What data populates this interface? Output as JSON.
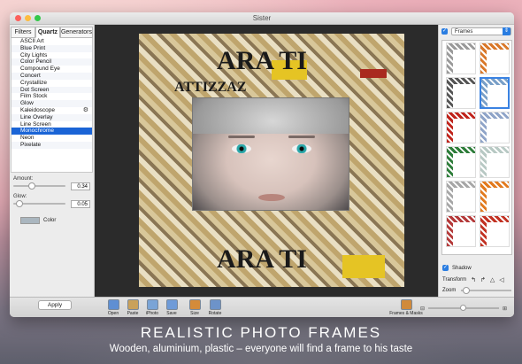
{
  "window": {
    "title": "Sister"
  },
  "left_panel": {
    "tabs": [
      {
        "label": "Filters",
        "active": false
      },
      {
        "label": "Quartz",
        "active": true
      },
      {
        "label": "Generators",
        "active": false
      }
    ],
    "filters": [
      "ASCII Art",
      "Blue Print",
      "City Lights",
      "Color Pencil",
      "Compound Eye",
      "Concert",
      "Crystallize",
      "Dot Screen",
      "Film Stock",
      "Glow",
      "Kaleidoscope",
      "Line Overlay",
      "Line Screen",
      "Monochrome",
      "Neon",
      "Pixelate"
    ],
    "selected_filter": "Monochrome",
    "amount": {
      "label": "Amount:",
      "value": "0.34",
      "level": 0.34
    },
    "glow": {
      "label": "Glow:",
      "value": "0.05",
      "level": 0.05
    },
    "color": {
      "label": "Color",
      "value_color": "#aab6bf"
    }
  },
  "canvas": {
    "frame_text_top": "ARA TI",
    "frame_text_mid": "ATTIZZAZ",
    "frame_text_bottom": "ARA TI",
    "frame_accent_colors": [
      "#e5c424",
      "#a92a1f"
    ]
  },
  "right_panel": {
    "frames_enabled": true,
    "category": "Frames",
    "thumbnails": [
      {
        "name": "frame-grey-stone",
        "color": "#9a9a9a"
      },
      {
        "name": "frame-orange-wood",
        "color": "#d9782a"
      },
      {
        "name": "frame-newspaper",
        "color": "#555555"
      },
      {
        "name": "frame-blue-sketch",
        "color": "#7aa0c8"
      },
      {
        "name": "frame-red",
        "color": "#c0241c"
      },
      {
        "name": "frame-steel-blue",
        "color": "#8fa4c8"
      },
      {
        "name": "frame-green-xmas",
        "color": "#2e7d3a"
      },
      {
        "name": "frame-floral",
        "color": "#b8c9c4"
      },
      {
        "name": "frame-silver-check",
        "color": "#a7a7a7"
      },
      {
        "name": "frame-orange-plain",
        "color": "#e27a1e"
      },
      {
        "name": "frame-candy",
        "color": "#b43a3a"
      },
      {
        "name": "frame-red-plain",
        "color": "#c23324"
      }
    ],
    "selected_thumbnail": 3,
    "shadow": {
      "label": "Shadow",
      "checked": true
    },
    "transform_label": "Transform",
    "transform_icons": [
      "↰",
      "↱",
      "△",
      "◁"
    ],
    "zoom_label": "Zoom"
  },
  "toolbar": {
    "apply_label": "Apply",
    "tools": [
      {
        "label": "Open",
        "icon": "open-icon",
        "color": "#5f8fd3"
      },
      {
        "label": "Paste",
        "icon": "paste-icon",
        "color": "#c9a15a"
      },
      {
        "label": "iPhoto",
        "icon": "iphoto-icon",
        "color": "#7aa4d6"
      },
      {
        "label": "Save",
        "icon": "save-icon",
        "color": "#6f9bd8"
      },
      {
        "label": "Size",
        "icon": "size-icon",
        "color": "#d48b3a"
      },
      {
        "label": "Rotate",
        "icon": "rotate-icon",
        "color": "#6d93c9"
      }
    ],
    "frames_masks_label": "Frames & Masks",
    "zoom_minus": "⊟",
    "zoom_plus": "⊞"
  },
  "promo": {
    "title": "REALISTIC PHOTO FRAMES",
    "subtitle": "Wooden, aluminium, plastic – everyone will find a frame to his taste"
  },
  "colors": {
    "accent": "#1a64d6",
    "selected_border": "#3a82e2"
  }
}
